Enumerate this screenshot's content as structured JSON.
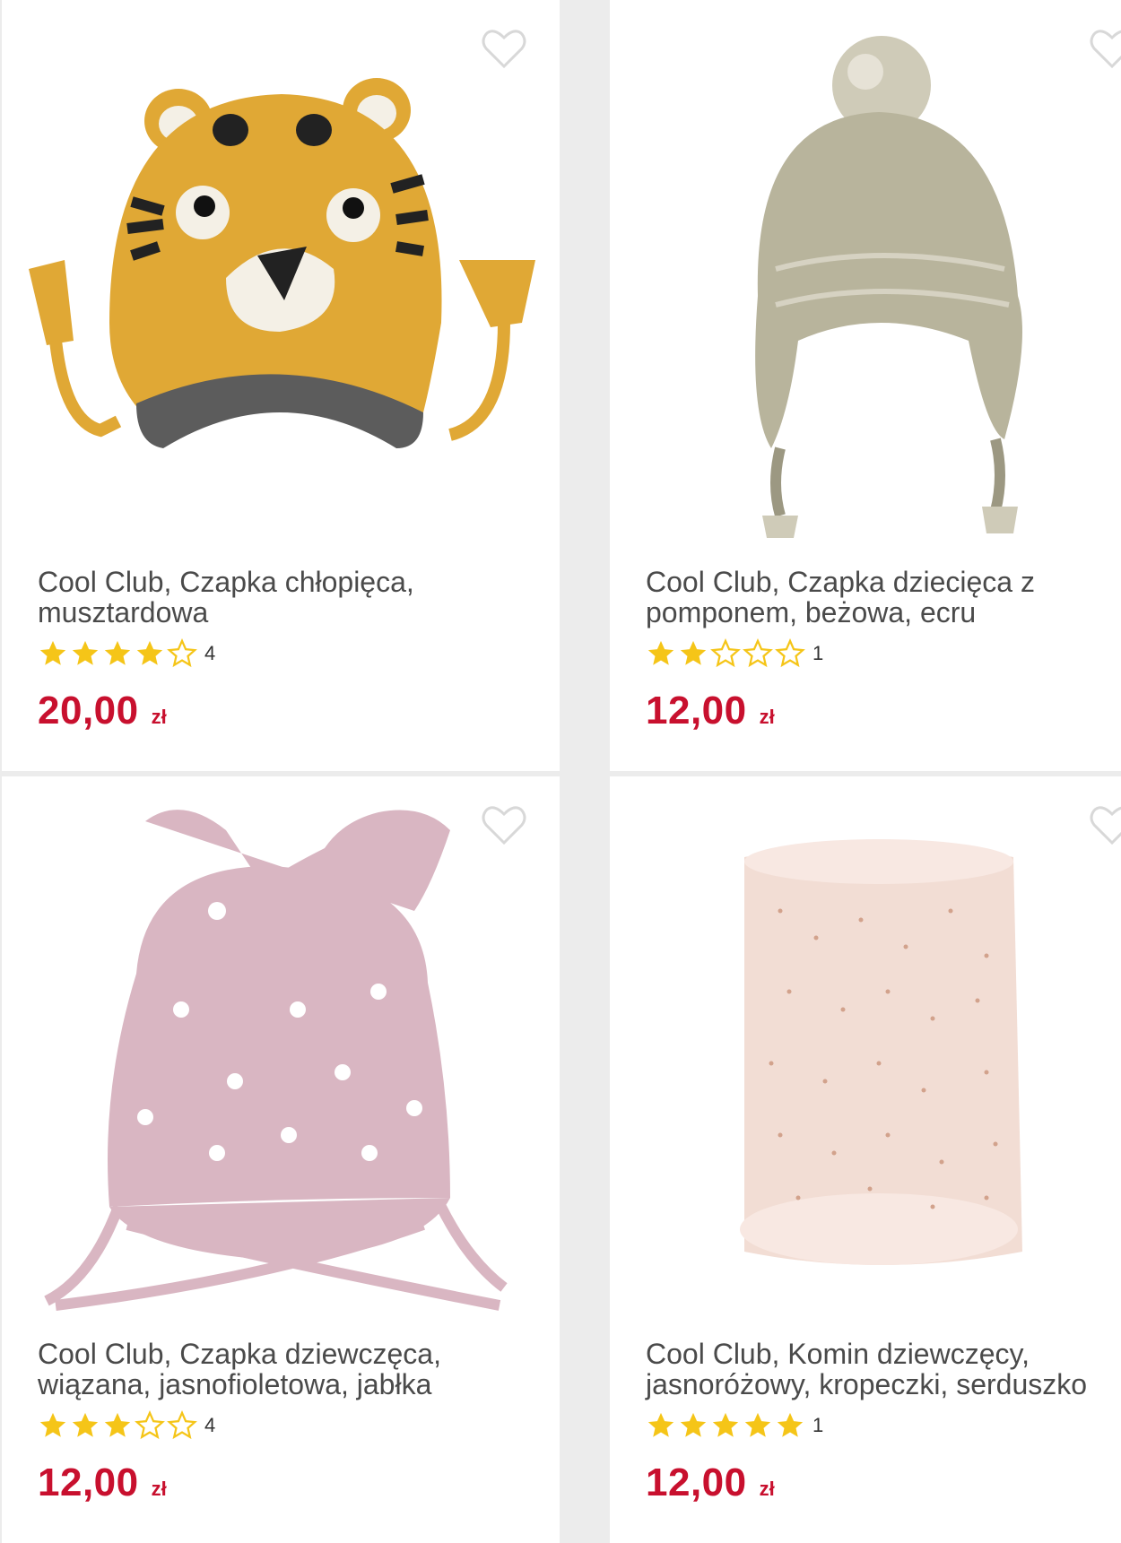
{
  "colors": {
    "price": "#c8102e",
    "star": "#f5c518",
    "title": "#4a4a4a",
    "heart": "#d8d8d8"
  },
  "products": [
    {
      "title": "Cool Club, Czapka chłopięca, musztardowa",
      "rating": 4,
      "review_count": "4",
      "price": "20,00",
      "currency": "zł",
      "image_icon": "tiger-hat-image"
    },
    {
      "title": "Cool Club, Czapka dziecięca z pomponem, beżowa, ecru",
      "rating": 2,
      "review_count": "1",
      "price": "12,00",
      "currency": "zł",
      "image_icon": "pompom-hat-image"
    },
    {
      "title": "Cool Club, Czapka dziewczęca, wiązana, jasnofioletowa, jabłka",
      "rating": 3,
      "review_count": "4",
      "price": "12,00",
      "currency": "zł",
      "image_icon": "tie-hat-image"
    },
    {
      "title": "Cool Club, Komin dziewczęcy, jasnoróżowy, kropeczki, serduszko",
      "rating": 5,
      "review_count": "1",
      "price": "12,00",
      "currency": "zł",
      "image_icon": "snood-image"
    }
  ]
}
